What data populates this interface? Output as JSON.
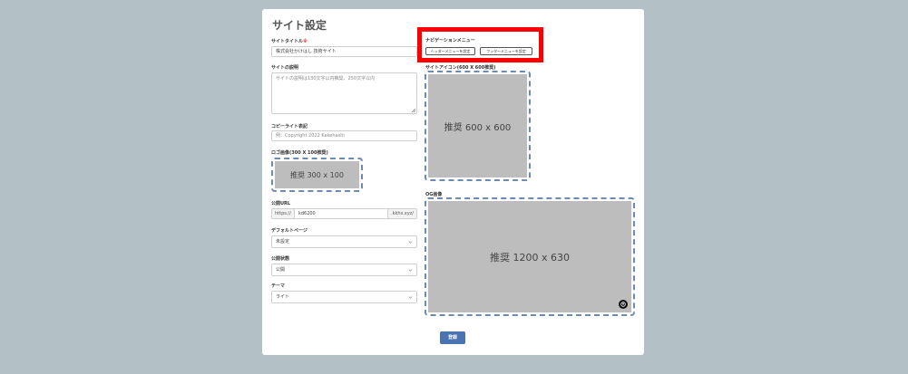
{
  "page": {
    "title": "サイト設定"
  },
  "site_title": {
    "label": "サイトタイトル",
    "required_mark": "※",
    "value": "株式会社かけはし 技術サイト"
  },
  "site_description": {
    "label": "サイトの説明",
    "placeholder": "サイトの説明は130文字以内推奨、250文字以内"
  },
  "copyright": {
    "label": "コピーライト表記",
    "placeholder": "例：Copyright 2022 Kakehashi"
  },
  "logo": {
    "label": "ロゴ画像(300 X 100推奨)",
    "placeholder": "推奨 300 x 100"
  },
  "public_url": {
    "label": "公開URL",
    "prefix": "https://",
    "value": "kd6200",
    "suffix": ".kkhs.xyz/"
  },
  "default_page": {
    "label": "デフォルトページ",
    "selected": "未設定"
  },
  "publish_status": {
    "label": "公開状態",
    "selected": "公開"
  },
  "theme": {
    "label": "テーマ",
    "selected": "ライト"
  },
  "navigation": {
    "label": "ナビゲーションメニュー",
    "header_button": "ヘッダーメニューを設定",
    "footer_button": "フッターメニューを設定"
  },
  "site_icon": {
    "label": "サイトアイコン(600 X 600推奨)",
    "placeholder": "推奨 600 x 600"
  },
  "og_image": {
    "label": "OG画像",
    "placeholder": "推奨 1200 x 630"
  },
  "actions": {
    "submit": "登録"
  },
  "colors": {
    "page_background": "#b3c0c6",
    "primary_button": "#4a73b1",
    "highlight_border": "#ff0000",
    "dropzone_border": "#6b8bb4"
  }
}
